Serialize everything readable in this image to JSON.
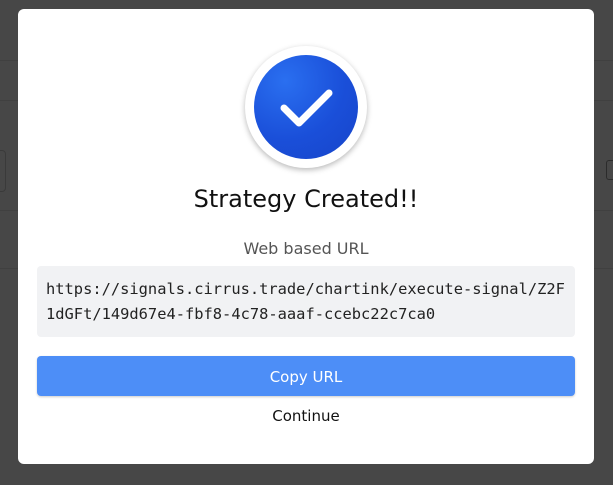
{
  "modal": {
    "title": "Strategy Created!!",
    "url_label": "Web based URL",
    "url_value": "https://signals.cirrus.trade/chartink/execute-signal/Z2F1dGFt/149d67e4-fbf8-4c78-aaaf-ccebc22c7ca0",
    "copy_button_label": "Copy URL",
    "continue_label": "Continue",
    "icon": "check-icon"
  },
  "colors": {
    "accent": "#4d8ef7",
    "badge": "#1a4fd9",
    "overlay": "rgba(0,0,0,0.72)"
  }
}
